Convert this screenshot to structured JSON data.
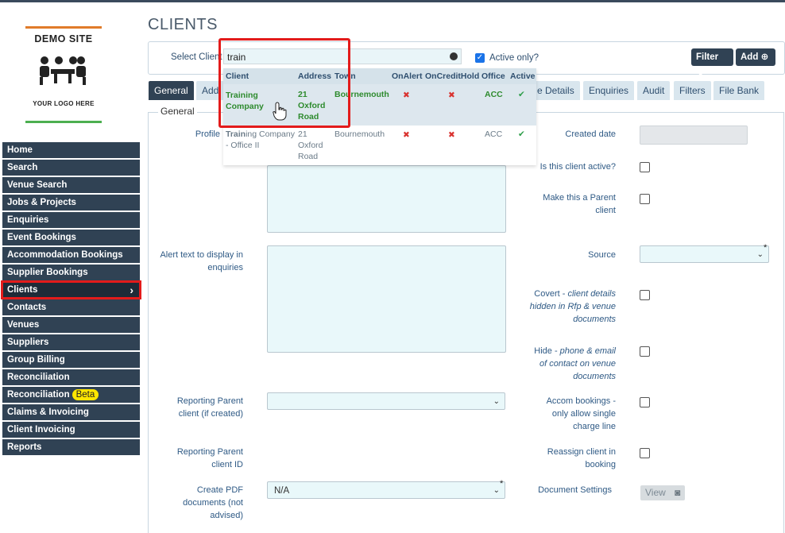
{
  "logo": {
    "title": "DEMO SITE",
    "subtitle": "YOUR LOGO HERE"
  },
  "sidebar": {
    "items": [
      {
        "label": "Home"
      },
      {
        "label": "Search"
      },
      {
        "label": "Venue Search"
      },
      {
        "label": "Jobs & Projects"
      },
      {
        "label": "Enquiries"
      },
      {
        "label": "Event Bookings"
      },
      {
        "label": "Accommodation Bookings"
      },
      {
        "label": "Supplier Bookings"
      },
      {
        "label": "Clients",
        "active": true
      },
      {
        "label": "Contacts"
      },
      {
        "label": "Venues"
      },
      {
        "label": "Suppliers"
      },
      {
        "label": "Group Billing"
      },
      {
        "label": "Reconciliation"
      },
      {
        "label": "Reconciliation",
        "badge": "Beta"
      },
      {
        "label": "Claims & Invoicing"
      },
      {
        "label": "Client Invoicing"
      },
      {
        "label": "Reports"
      }
    ]
  },
  "page": {
    "title": "CLIENTS"
  },
  "select_client": {
    "label": "Select Client",
    "value": "train",
    "active_only_label": "Active only?",
    "active_only_checked": true,
    "filter_label": "Filter",
    "add_label": "Add"
  },
  "tabs": [
    {
      "label": "General",
      "active": true
    },
    {
      "label": "Add"
    },
    {
      "label": "e Details"
    },
    {
      "label": "Enquiries"
    },
    {
      "label": "Audit"
    },
    {
      "label": "Filters"
    },
    {
      "label": "File Bank"
    }
  ],
  "dropdown": {
    "headers": [
      "Client",
      "Address",
      "Town",
      "OnAlert",
      "OnCreditHold",
      "Office",
      "Active"
    ],
    "rows": [
      {
        "client_match": "Train",
        "client_rest": "ing Company",
        "address": "21 Oxford Road",
        "town": "Bournemouth",
        "on_alert": "✖",
        "on_credit_hold": "✖",
        "office": "ACC",
        "active": "✔"
      },
      {
        "client_match": "Train",
        "client_rest": "ing Company - Office II",
        "address": "21 Oxford Road",
        "town": "Bournemouth",
        "on_alert": "✖",
        "on_credit_hold": "✖",
        "office": "ACC",
        "active": "✔"
      }
    ]
  },
  "general": {
    "legend": "General",
    "profile_label": "Profile",
    "alert_text_label": "Alert text to display in enquiries",
    "reporting_parent_label": "Reporting Parent client (if created)",
    "reporting_parent_id_label": "Reporting Parent client ID",
    "create_pdf_label": "Create PDF documents (not advised)",
    "create_pdf_value": "N/A",
    "created_date_label": "Created date",
    "is_active_label": "Is this client active?",
    "make_parent_label": "Make this a Parent client",
    "source_label": "Source",
    "covert_label": "Covert - ",
    "covert_italic": "client details hidden in Rfp & venue documents",
    "hide_label": "Hide - ",
    "hide_italic": "phone & email of contact on venue documents",
    "accom_label": "Accom bookings - only allow single charge line",
    "reassign_label": "Reassign client in booking",
    "document_settings_label": "Document Settings",
    "view_label": "View"
  }
}
